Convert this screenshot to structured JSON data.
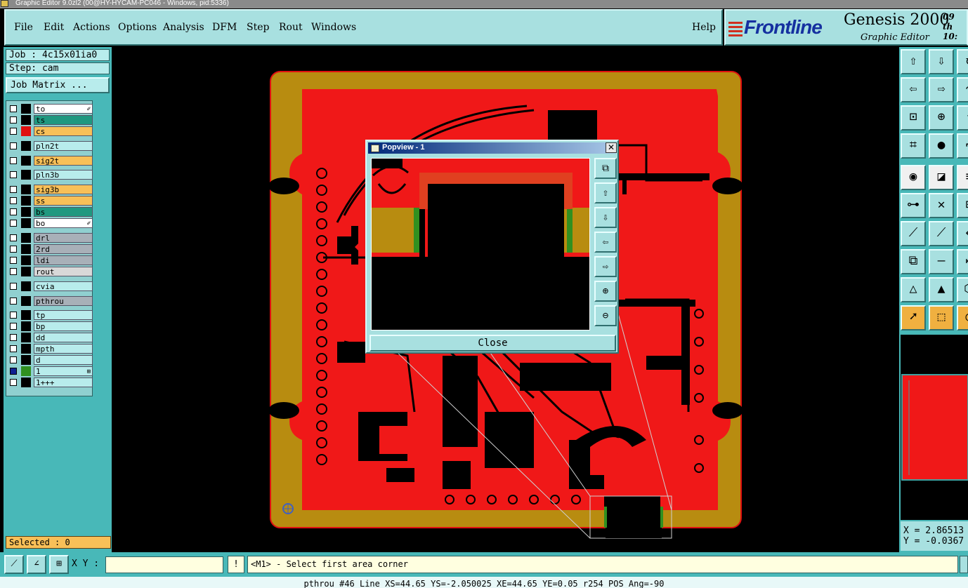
{
  "window": {
    "title": "Graphic Editor 9.0zl2 (00@HY-HYCAM-PC046 - Windows, pid:5336)"
  },
  "menu": [
    "File",
    "Edit",
    "Actions",
    "Options",
    "Analysis",
    "DFM",
    "Step",
    "Rout",
    "Windows"
  ],
  "help": "Help",
  "brand": {
    "logo": "Frontline",
    "product": "Genesis 2000",
    "subtitle": "Graphic Editor",
    "date": "09 th",
    "time": "10:"
  },
  "job": {
    "job": "Job : 4c15x01ia0",
    "step": "Step: cam",
    "matrix_button": "Job Matrix ..."
  },
  "layers": [
    {
      "name": "to",
      "color": "#ffffff",
      "swatch": "#000000",
      "flag": "✐"
    },
    {
      "name": "ts",
      "color": "#209880",
      "swatch": "#000000",
      "flag": ""
    },
    {
      "name": "cs",
      "color": "#f8c058",
      "swatch": "#e01010",
      "flag": ""
    },
    {
      "name": "pln2t",
      "color": "#b8ecec",
      "swatch": "#000000",
      "flag": ""
    },
    {
      "name": "sig2t",
      "color": "#f8c058",
      "swatch": "#000000",
      "flag": ""
    },
    {
      "name": "pln3b",
      "color": "#b8ecec",
      "swatch": "#000000",
      "flag": ""
    },
    {
      "name": "sig3b",
      "color": "#f8c058",
      "swatch": "#000000",
      "flag": ""
    },
    {
      "name": "ss",
      "color": "#f8c058",
      "swatch": "#000000",
      "flag": ""
    },
    {
      "name": "bs",
      "color": "#209880",
      "swatch": "#000000",
      "flag": ""
    },
    {
      "name": "bo",
      "color": "#ffffff",
      "swatch": "#000000",
      "flag": "✐"
    },
    {
      "name": "drl",
      "color": "#a8b0b8",
      "swatch": "#000000",
      "flag": ""
    },
    {
      "name": "2rd",
      "color": "#a8b0b8",
      "swatch": "#000000",
      "flag": ""
    },
    {
      "name": "ldi",
      "color": "#a8b0b8",
      "swatch": "#000000",
      "flag": ""
    },
    {
      "name": "rout",
      "color": "#d8d8d8",
      "swatch": "#000000",
      "flag": ""
    },
    {
      "name": "cvia",
      "color": "#b8ecec",
      "swatch": "#000000",
      "flag": ""
    },
    {
      "name": "pthrou",
      "color": "#a8b0b8",
      "swatch": "#000000",
      "flag": ""
    },
    {
      "name": "tp",
      "color": "#b8ecec",
      "swatch": "#000000",
      "flag": ""
    },
    {
      "name": "bp",
      "color": "#b8ecec",
      "swatch": "#000000",
      "flag": ""
    },
    {
      "name": "dd",
      "color": "#b8ecec",
      "swatch": "#000000",
      "flag": ""
    },
    {
      "name": "mpth",
      "color": "#b8ecec",
      "swatch": "#000000",
      "flag": ""
    },
    {
      "name": "d",
      "color": "#b8ecec",
      "swatch": "#000000",
      "flag": ""
    },
    {
      "name": "1",
      "color": "#b8ecec",
      "swatch": "#309020",
      "flag": "⊞"
    },
    {
      "name": "1+++",
      "color": "#b8ecec",
      "swatch": "#000000",
      "flag": ""
    }
  ],
  "selected": "Selected : 0",
  "popup": {
    "title": "Popview - 1",
    "close": "Close",
    "close_x": "✕"
  },
  "coords": {
    "x": "X = 2.86513",
    "y": "Y = -0.0367"
  },
  "bottom": {
    "xy_label": "X Y :",
    "xy_value": "",
    "excl": "!",
    "message": "<M1> - Select first area corner"
  },
  "status": "pthrou #46 Line XS=44.65 YS=-2.050025 XE=44.65 YE=0.05 r254 POS Ang=-90"
}
